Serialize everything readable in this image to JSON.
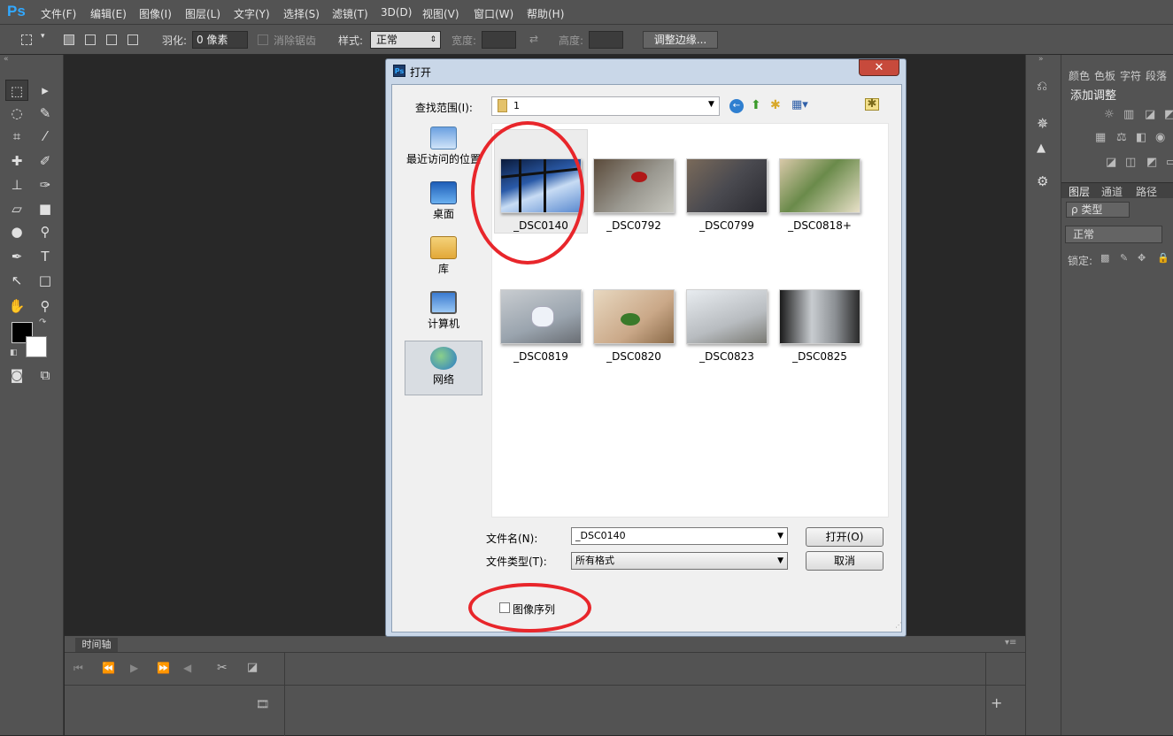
{
  "app": {
    "logo": "Ps"
  },
  "menu": [
    "文件(F)",
    "编辑(E)",
    "图像(I)",
    "图层(L)",
    "文字(Y)",
    "选择(S)",
    "滤镜(T)",
    "3D(D)",
    "视图(V)",
    "窗口(W)",
    "帮助(H)"
  ],
  "options": {
    "feather_label": "羽化:",
    "feather_value": "0 像素",
    "antialias_label": "消除锯齿",
    "style_label": "样式:",
    "style_value": "正常",
    "width_label": "宽度:",
    "height_label": "高度:",
    "refine_edge_button": "调整边缘..."
  },
  "right_panel": {
    "tabs_top": [
      "颜色",
      "色板",
      "字符",
      "段落"
    ],
    "adjust_title": "添加调整",
    "tabs_layers": [
      "图层",
      "通道",
      "路径"
    ],
    "kind_filter": "ρ 类型",
    "blend_mode": "正常",
    "lock_label": "锁定:"
  },
  "timeline": {
    "tab": "时间轴"
  },
  "dialog": {
    "title": "打开",
    "lookin_label": "查找范围(I):",
    "lookin_value": "1",
    "places": [
      "最近访问的位置",
      "桌面",
      "库",
      "计算机",
      "网络"
    ],
    "files": [
      "_DSC0140",
      "_DSC0792",
      "_DSC0799",
      "_DSC0818+",
      "_DSC0819",
      "_DSC0820",
      "_DSC0823",
      "_DSC0825"
    ],
    "filename_label": "文件名(N):",
    "filename_value": "_DSC0140",
    "filetype_label": "文件类型(T):",
    "filetype_value": "所有格式",
    "open_button": "打开(O)",
    "cancel_button": "取消",
    "image_sequence_label": "图像序列"
  },
  "colors": {
    "ui_gray": "#535353",
    "canvas": "#282828",
    "annotation_red": "#e8262b"
  }
}
